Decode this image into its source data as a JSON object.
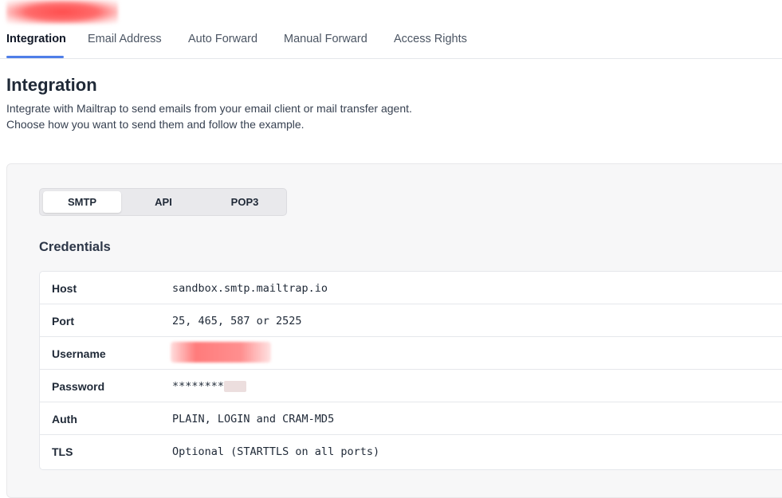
{
  "tabs": [
    {
      "label": "Integration",
      "active": true
    },
    {
      "label": "Email Address",
      "active": false
    },
    {
      "label": "Auto Forward",
      "active": false
    },
    {
      "label": "Manual Forward",
      "active": false
    },
    {
      "label": "Access Rights",
      "active": false
    }
  ],
  "page": {
    "title": "Integration",
    "description_line1": "Integrate with Mailtrap to send emails from your email client or mail transfer agent.",
    "description_line2": "Choose how you want to send them and follow the example."
  },
  "methods": [
    {
      "label": "SMTP",
      "active": true
    },
    {
      "label": "API",
      "active": false
    },
    {
      "label": "POP3",
      "active": false
    }
  ],
  "credentials": {
    "title": "Credentials",
    "rows": [
      {
        "key": "Host",
        "value": "sandbox.smtp.mailtrap.io"
      },
      {
        "key": "Port",
        "value": "25, 465, 587 or 2525"
      },
      {
        "key": "Username",
        "value": ""
      },
      {
        "key": "Password",
        "value": "********"
      },
      {
        "key": "Auth",
        "value": "PLAIN, LOGIN and CRAM-MD5"
      },
      {
        "key": "TLS",
        "value": "Optional (STARTTLS on all ports)"
      }
    ]
  },
  "colors": {
    "accent": "#4f7ee8",
    "panel_bg": "#f7f7f8",
    "text": "#1f2937"
  }
}
